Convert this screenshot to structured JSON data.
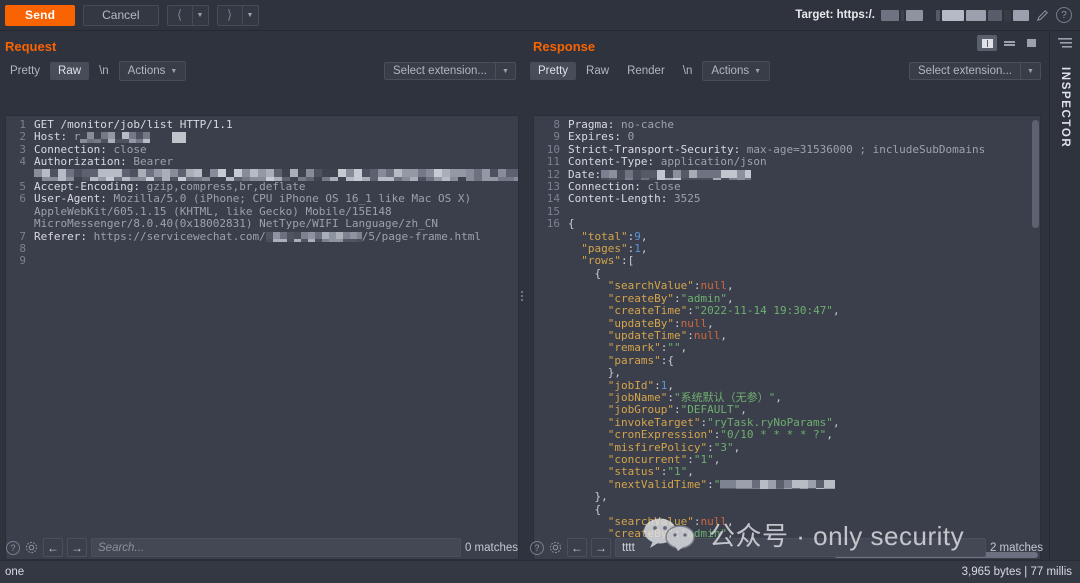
{
  "toolbar": {
    "send_label": "Send",
    "cancel_label": "Cancel",
    "back_icon": "chevron-left-icon",
    "forward_icon": "chevron-right-icon",
    "target_label": "Target: https:/.",
    "target_value_redacted": true,
    "edit_icon": "pencil-icon",
    "help_icon": "question-mark-icon"
  },
  "request": {
    "title": "Request",
    "tabs": [
      "Pretty",
      "Raw",
      "\\n"
    ],
    "selected_tab": "Raw",
    "actions_label": "Actions",
    "extension_select_label": "Select extension...",
    "line_numbers": [
      "1",
      "2",
      "3",
      "4",
      "",
      "",
      "5",
      "6",
      "",
      "",
      "7",
      "8",
      "9"
    ],
    "lines": [
      {
        "n": "1",
        "type": "start",
        "text": "GET /monitor/job/list HTTP/1.1"
      },
      {
        "n": "2",
        "type": "header",
        "key": "Host:",
        "value": " r"
      },
      {
        "n": "3",
        "type": "header",
        "key": "Connection:",
        "value": " close"
      },
      {
        "n": "4",
        "type": "header",
        "key": "Authorization:",
        "value": " Bearer"
      },
      {
        "n": "",
        "type": "redacted",
        "text": ""
      },
      {
        "n": "5",
        "type": "header",
        "key": "Accept-Encoding:",
        "value": " gzip,compress,br,deflate"
      },
      {
        "n": "6",
        "type": "header",
        "key": "User-Agent:",
        "value": " Mozilla/5.0 (iPhone; CPU iPhone OS 16_1 like Mac OS X)"
      },
      {
        "n": "",
        "type": "cont",
        "text": "AppleWebKit/605.1.15 (KHTML, like Gecko) Mobile/15E148"
      },
      {
        "n": "",
        "type": "cont",
        "text": "MicroMessenger/8.0.40(0x18002831) NetType/WIFI Language/zh_CN"
      },
      {
        "n": "7",
        "type": "header",
        "key": "Referer:",
        "value": " https://servicewechat.com/",
        "tail": "/5/page-frame.html"
      },
      {
        "n": "8",
        "type": "blank",
        "text": ""
      },
      {
        "n": "9",
        "type": "blank",
        "text": ""
      }
    ],
    "search_placeholder": "Search...",
    "search_value": "",
    "matches": "0 matches",
    "help_icon": "question-mark-icon",
    "settings_icon": "gear-icon",
    "prev_icon": "arrow-left-icon",
    "next_icon": "arrow-right-icon"
  },
  "response": {
    "title": "Response",
    "tabs": [
      "Pretty",
      "Raw",
      "Render",
      "\\n"
    ],
    "selected_tab": "Pretty",
    "actions_label": "Actions",
    "extension_select_label": "Select extension...",
    "layout_buttons": [
      "side-by-side-layout-icon",
      "stacked-layout-icon",
      "single-layout-icon"
    ],
    "selected_layout": "side-by-side-layout-icon",
    "headers": [
      {
        "n": "8",
        "key": "Pragma:",
        "value": " no-cache"
      },
      {
        "n": "9",
        "key": "Expires:",
        "value": " 0"
      },
      {
        "n": "10",
        "key": "Strict-Transport-Security:",
        "value": " max-age=31536000 ; includeSubDomains"
      },
      {
        "n": "11",
        "key": "Content-Type:",
        "value": " application/json"
      },
      {
        "n": "12",
        "key": "Date:",
        "value": "",
        "redacted": true
      },
      {
        "n": "13",
        "key": "Connection:",
        "value": " close"
      },
      {
        "n": "14",
        "key": "Content-Length:",
        "value": " 3525"
      },
      {
        "n": "15",
        "key": "",
        "value": ""
      }
    ],
    "body_start_line": "16",
    "body": [
      {
        "indent": 0,
        "punct": "{"
      },
      {
        "indent": 1,
        "key": "\"total\"",
        "sep": ":",
        "num": "9",
        "punct": ","
      },
      {
        "indent": 1,
        "key": "\"pages\"",
        "sep": ":",
        "num": "1",
        "punct": ","
      },
      {
        "indent": 1,
        "key": "\"rows\"",
        "sep": ":",
        "punct": "["
      },
      {
        "indent": 2,
        "punct": "{"
      },
      {
        "indent": 3,
        "key": "\"searchValue\"",
        "sep": ":",
        "null": "null",
        "punct": ","
      },
      {
        "indent": 3,
        "key": "\"createBy\"",
        "sep": ":",
        "str": "\"admin\"",
        "punct": ","
      },
      {
        "indent": 3,
        "key": "\"createTime\"",
        "sep": ":",
        "str": "\"2022-11-14 19:30:47\"",
        "punct": ","
      },
      {
        "indent": 3,
        "key": "\"updateBy\"",
        "sep": ":",
        "null": "null",
        "punct": ","
      },
      {
        "indent": 3,
        "key": "\"updateTime\"",
        "sep": ":",
        "null": "null",
        "punct": ","
      },
      {
        "indent": 3,
        "key": "\"remark\"",
        "sep": ":",
        "str": "\"\"",
        "punct": ","
      },
      {
        "indent": 3,
        "key": "\"params\"",
        "sep": ":",
        "punct": "{"
      },
      {
        "indent": 3,
        "punct": "},"
      },
      {
        "indent": 3,
        "key": "\"jobId\"",
        "sep": ":",
        "num": "1",
        "punct": ","
      },
      {
        "indent": 3,
        "key": "\"jobName\"",
        "sep": ":",
        "str": "\"系统默认（无参）\"",
        "punct": ","
      },
      {
        "indent": 3,
        "key": "\"jobGroup\"",
        "sep": ":",
        "str": "\"DEFAULT\"",
        "punct": ","
      },
      {
        "indent": 3,
        "key": "\"invokeTarget\"",
        "sep": ":",
        "str": "\"ryTask.ryNoParams\"",
        "punct": ","
      },
      {
        "indent": 3,
        "key": "\"cronExpression\"",
        "sep": ":",
        "str": "\"0/10 * * * * ?\"",
        "punct": ","
      },
      {
        "indent": 3,
        "key": "\"misfirePolicy\"",
        "sep": ":",
        "str": "\"3\"",
        "punct": ","
      },
      {
        "indent": 3,
        "key": "\"concurrent\"",
        "sep": ":",
        "str": "\"1\"",
        "punct": ","
      },
      {
        "indent": 3,
        "key": "\"status\"",
        "sep": ":",
        "str": "\"1\"",
        "punct": ","
      },
      {
        "indent": 3,
        "key": "\"nextValidTime\"",
        "sep": ":",
        "str": "\"",
        "redacted": true
      },
      {
        "indent": 2,
        "punct": "},"
      },
      {
        "indent": 2,
        "punct": "{"
      },
      {
        "indent": 3,
        "key": "\"searchValue\"",
        "sep": ":",
        "null": "null",
        "punct": ","
      },
      {
        "indent": 3,
        "key": "\"createBy\"",
        "sep": ":",
        "str": "\"admin\"",
        "punct": ","
      }
    ],
    "search_placeholder": "",
    "search_value": "tttt",
    "matches": "2 matches",
    "help_icon": "question-mark-icon",
    "settings_icon": "gear-icon",
    "prev_icon": "arrow-left-icon",
    "next_icon": "arrow-right-icon"
  },
  "inspector": {
    "label": "INSPECTOR",
    "menu_icon": "hamburger-icon"
  },
  "statusbar": {
    "left_text": "one",
    "right_text": "3,965 bytes | 77 millis"
  },
  "watermark": {
    "text": "公众号 · only security",
    "icon": "wechat-icon"
  },
  "colors": {
    "accent": "#f96302",
    "app_bg": "#2f333d",
    "editor_bg": "#3a3f4b",
    "json_key": "#d5a44b",
    "json_string": "#6fae6f",
    "json_number": "#5c94d6",
    "json_null": "#d2673f"
  }
}
